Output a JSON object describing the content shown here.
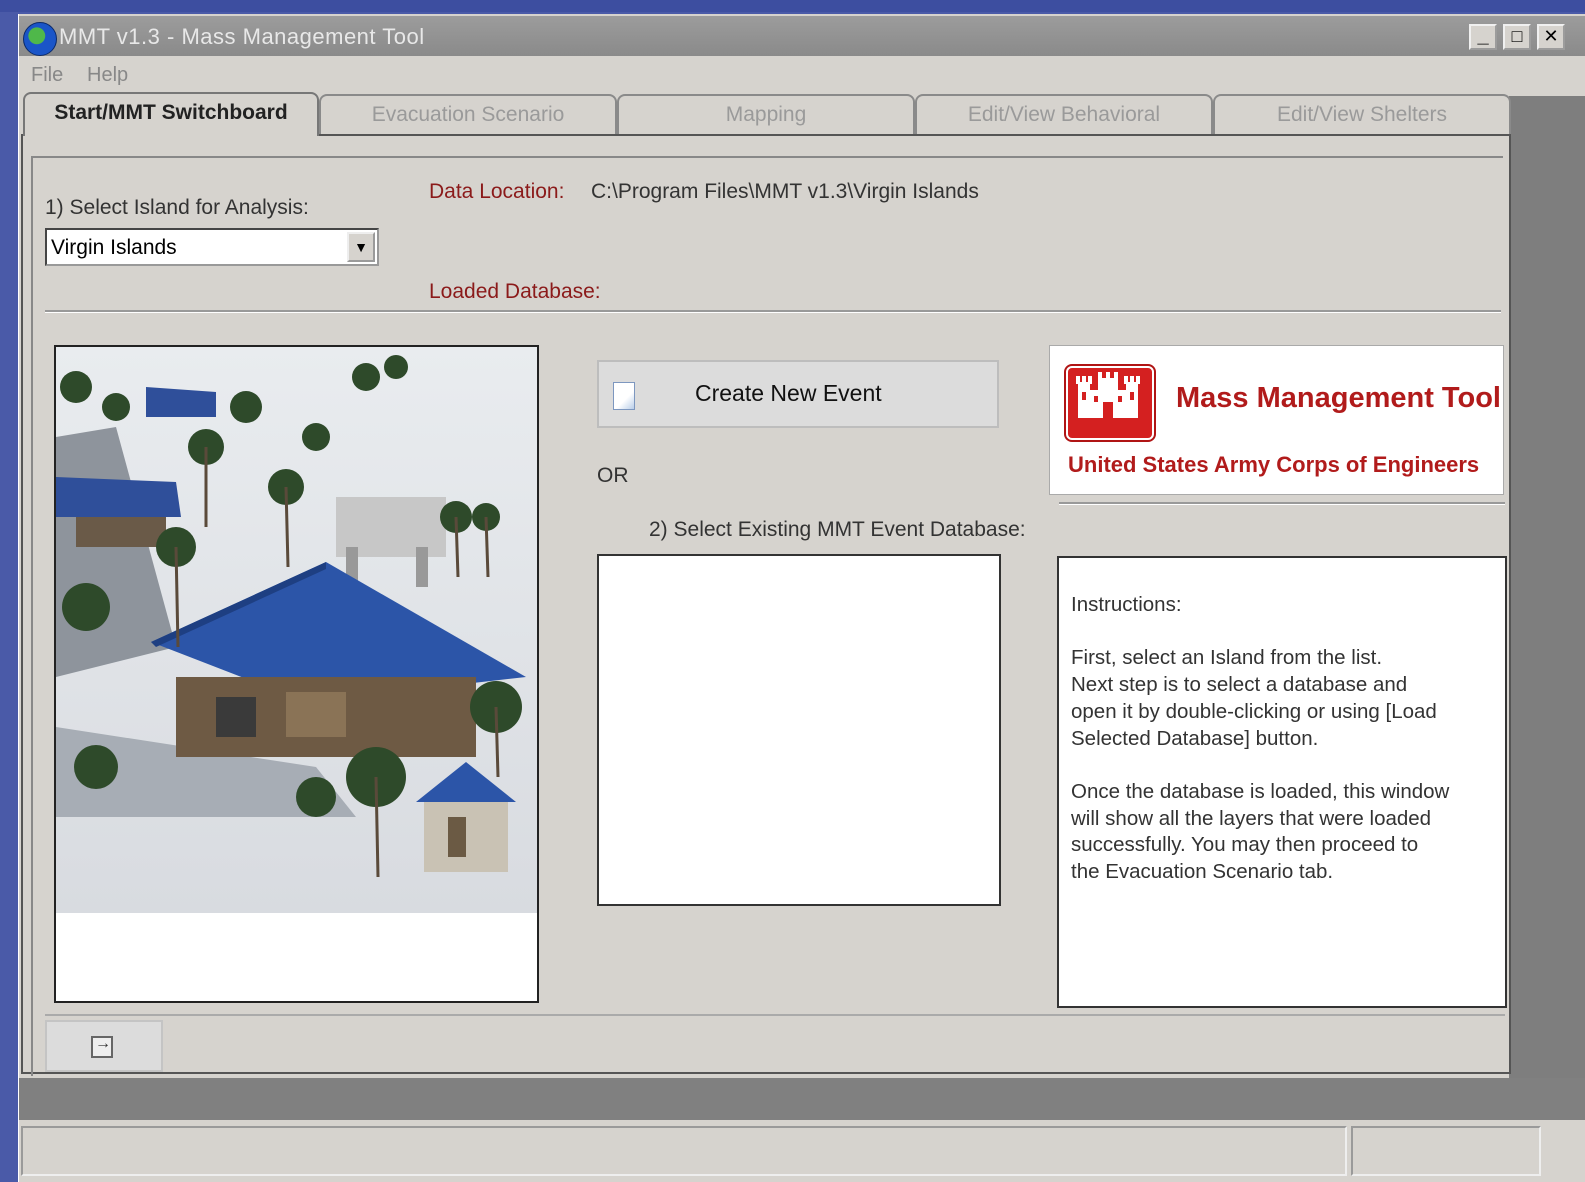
{
  "window": {
    "title": "MMT v1.3 - Mass Management Tool",
    "controls": {
      "minimize": "_",
      "maximize": "□",
      "close": "✕"
    }
  },
  "menu": [
    "File",
    "Help"
  ],
  "tabs": [
    {
      "label": "Start/MMT Switchboard",
      "active": true
    },
    {
      "label": "Evacuation Scenario",
      "active": false
    },
    {
      "label": "Mapping",
      "active": false
    },
    {
      "label": "Edit/View Behavioral",
      "active": false
    },
    {
      "label": "Edit/View Shelters",
      "active": false
    }
  ],
  "switchboard": {
    "select_island_label": "1) Select Island for Analysis:",
    "island_value": "Virgin Islands",
    "data_location_label": "Data Location:",
    "data_location_value": "C:\\Program Files\\MMT v1.3\\Virgin Islands",
    "loaded_database_label": "Loaded Database:",
    "create_button_label": "Create New Event",
    "or_label": "OR",
    "select_existing_label": "2) Select Existing MMT Event Database:",
    "logo": {
      "title": "Mass Management Tool",
      "subtitle": "United States Army Corps of Engineers"
    },
    "instructions": "Instructions:\n\nFirst, select an Island from the list.\nNext step is to select a database and\nopen it by double-clicking or using [Load\nSelected Database] button.\n\nOnce the database is loaded, this window\nwill show all the layers that were loaded\nsuccessfully.  You may then proceed to\nthe Evacuation Scenario tab."
  },
  "colors": {
    "accent_red": "#8b1a1a",
    "logo_red": "#b11b1b",
    "window_gray": "#d6d3ce",
    "titlebar_gray": "#9c9c9c"
  }
}
